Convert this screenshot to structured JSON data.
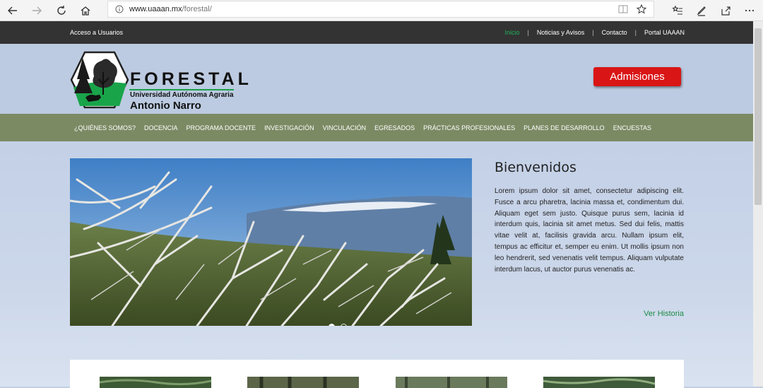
{
  "browser": {
    "url_host": "www.uaaan.mx",
    "url_path": "/forestal/"
  },
  "topbar": {
    "login": "Acceso a Usuarios",
    "links": [
      "Inicio",
      "Noticias y Avisos",
      "Contacto",
      "Portal UAAAN"
    ]
  },
  "logo": {
    "title": "FORESTAL",
    "subtitle1": "Universidad Autónoma Agraria",
    "subtitle2": "Antonio Narro"
  },
  "header": {
    "admisiones": "Admisiones"
  },
  "nav": [
    "¿QUIÉNES SOMOS?",
    "DOCENCIA",
    "PROGRAMA DOCENTE",
    "INVESTIGACIÓN",
    "VINCULACIÓN",
    "EGRESADOS",
    "PRÁCTICAS PROFESIONALES",
    "PLANES DE DESARROLLO",
    "ENCUESTAS"
  ],
  "welcome": {
    "title": "Bienvenidos",
    "body": "Lorem ipsum dolor sit amet, consectetur adipiscing elit. Fusce a arcu pharetra, lacinia massa et, condimentum dui. Aliquam eget sem justo. Quisque purus sem, lacinia id interdum quis, lacinia sit amet metus. Sed dui felis, mattis vitae velit at, facilisis gravida arcu. Nullam ipsum elit, tempus ac efficitur et, semper eu enim. Ut mollis ipsum non leo hendrerit, sed venenatis velit tempus. Aliquam vulputate interdum lacus, ut auctor purus venenatis ac.",
    "more": "Ver Historia"
  },
  "slider": {
    "slides": 2,
    "active": 1
  },
  "colors": {
    "topbar": "#333333",
    "nav": "#7c8a64",
    "accent": "#d91515",
    "active_link": "#1fb25a"
  }
}
